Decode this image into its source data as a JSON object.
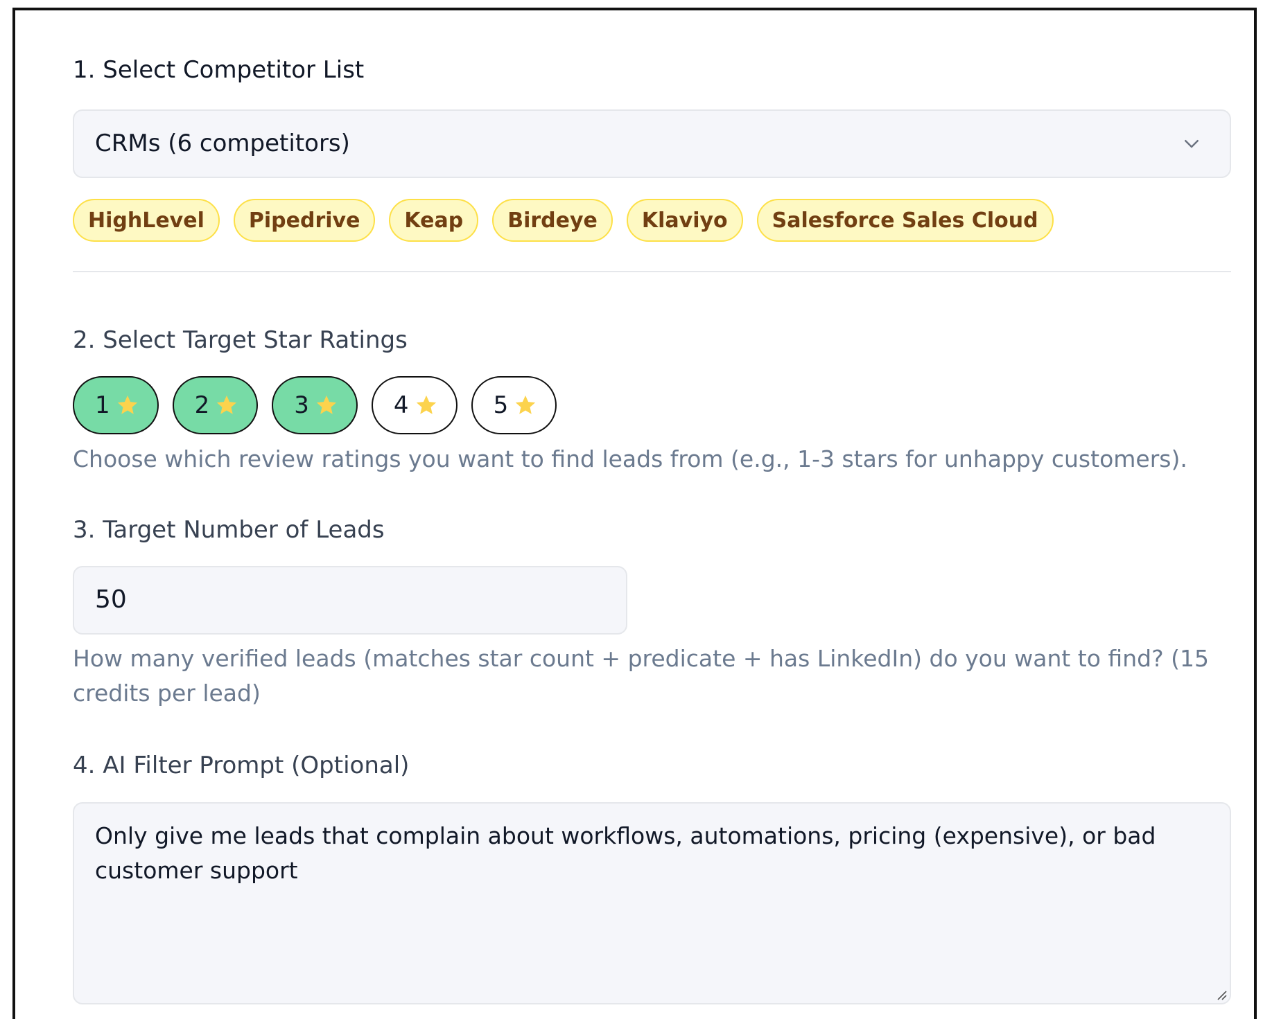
{
  "section1": {
    "label": "1. Select Competitor List",
    "select_value": "CRMs (6 competitors)",
    "competitors": [
      "HighLevel",
      "Pipedrive",
      "Keap",
      "Birdeye",
      "Klaviyo",
      "Salesforce Sales Cloud"
    ]
  },
  "section2": {
    "label": "2. Select Target Star Ratings",
    "ratings": [
      {
        "value": "1",
        "selected": true
      },
      {
        "value": "2",
        "selected": true
      },
      {
        "value": "3",
        "selected": true
      },
      {
        "value": "4",
        "selected": false
      },
      {
        "value": "5",
        "selected": false
      }
    ],
    "help": "Choose which review ratings you want to find leads from (e.g., 1-3 stars for unhappy customers)."
  },
  "section3": {
    "label": "3. Target Number of Leads",
    "value": "50",
    "help": "How many verified leads (matches star count + predicate + has LinkedIn) do you want to find? (15 credits per lead)"
  },
  "section4": {
    "label": "4. AI Filter Prompt (Optional)",
    "value": "Only give me leads that complain about workflows, automations, pricing (expensive), or bad customer support"
  },
  "colors": {
    "chip_bg": "#fef9c3",
    "chip_border": "#fde047",
    "chip_text": "#713f12",
    "rating_selected": "#77dba6",
    "star": "#fcd34d",
    "help_text": "#6b7a8f"
  },
  "icons": {
    "select_chevron": "chevron-down-icon",
    "rating_star": "star-icon",
    "textarea_resize": "resize-handle-icon"
  }
}
